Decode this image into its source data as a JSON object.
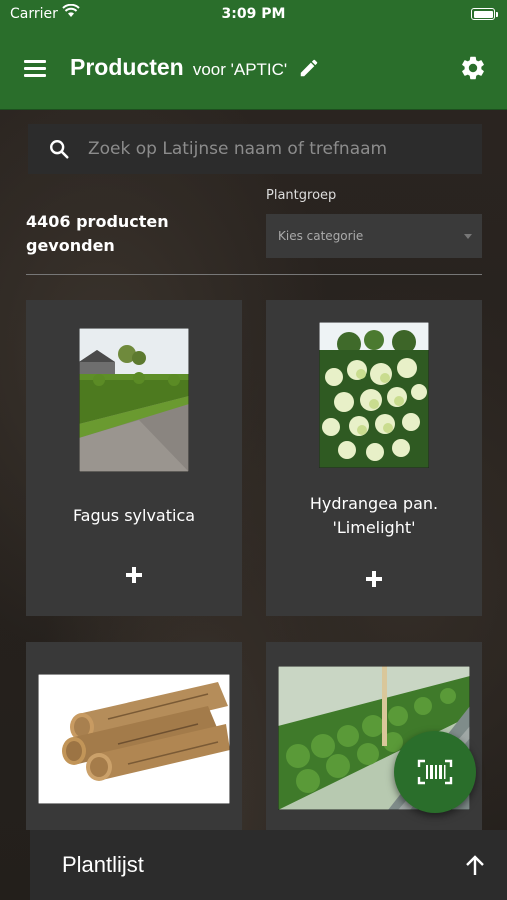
{
  "status_bar": {
    "carrier": "Carrier",
    "time": "3:09 PM"
  },
  "header": {
    "title": "Producten",
    "subtitle": "voor 'APTIC'",
    "menu_icon": "hamburger-menu-icon",
    "edit_icon": "pencil-icon",
    "settings_icon": "gear-icon",
    "background_color": "#2a6e2b"
  },
  "search": {
    "placeholder": "Zoek op Latijnse naam of trefnaam",
    "value": ""
  },
  "results": {
    "count_text": "4406 producten gevonden"
  },
  "filter": {
    "label": "Plantgroep",
    "selected": "Kies categorie"
  },
  "products": [
    {
      "name": "Fagus sylvatica",
      "image": "beech-hedge-photo"
    },
    {
      "name": "Hydrangea pan. 'Limelight'",
      "image": "white-hydrangea-photo"
    },
    {
      "name": "",
      "image": "wooden-stakes-photo"
    },
    {
      "name": "",
      "image": "hedge-row-photo"
    }
  ],
  "scan_button": {
    "icon": "barcode-scan-icon"
  },
  "bottom_sheet": {
    "label": "Plantlijst",
    "icon": "arrow-up-icon"
  }
}
